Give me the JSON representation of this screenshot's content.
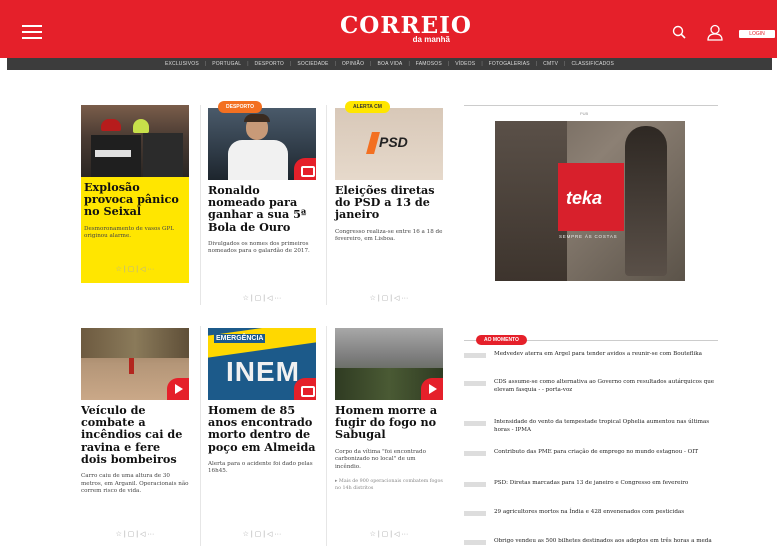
{
  "header": {
    "logo_main": "CORREIO",
    "logo_sub": "da manhã",
    "login_label": "LOGIN"
  },
  "nav": [
    "EXCLUSIVOS",
    "PORTUGAL",
    "DESPORTO",
    "SOCIEDADE",
    "OPINIÃO",
    "BOA VIDA",
    "FAMOSOS",
    "VÍDEOS",
    "FOTOGALERIAS",
    "CMTV",
    "CLASSIFICADOS"
  ],
  "cards": [
    {
      "title": "Explosão provoca pânico no Seixal",
      "lead": "Desmoronamento de vasos GPL originou alarme.",
      "tag": ""
    },
    {
      "title": "Ronaldo nomeado para ganhar a sua 5ª Bola de Ouro",
      "lead": "Divulgados os nomes dos primeiros nomeados para o galardão de 2017.",
      "tag": "DESPORTO"
    },
    {
      "title": "Eleições diretas do PSD a 13 de janeiro",
      "lead": "Congresso realiza-se entre 16 a 18 de fevereiro, em Lisboa.",
      "tag": "ALERTA CM",
      "image_text": "PSD"
    },
    {
      "title": "Veículo de combate a incêndios cai de ravina e fere dois bombeiros",
      "lead": "Carro caiu de uma altura de 30 metros, em Arganil. Operacionais não correm risco de vida."
    },
    {
      "title": "Homem de 85 anos encontrado morto dentro de poço em Almeida",
      "lead": "Alerta para o acidente foi dado pelas 16h45.",
      "image_text_top": "EMERGÊNCIA",
      "image_text": "INEM"
    },
    {
      "title": "Homem morre a fugir do fogo no Sabugal",
      "lead": "Corpo da vítima \"foi encontrado carbonizado no local\" de um incêndio.",
      "related": "▸ Mais de 900 operacionais combatem fogos no 14h distritos"
    }
  ],
  "actions": "☆ | ▢ | ◁ ···",
  "ad": {
    "label": "PUB",
    "brand": "teka",
    "slogan": "SEMPRE ÁS COSTAS"
  },
  "latest": {
    "label": "AO MOMENTO",
    "items": [
      "Medvedev aterra em Argel para tender avidos a reunir-se com Bouteflika",
      "CDS assume-se como alternativa ao Governo com resultados autárquicos que elevam fasquia - - porta-voz",
      "Intensidade do vento da tempestade tropical Ophelia aumentou nas últimas horas - IPMA",
      "Contributo das PME para criação de emprego no mundo estagnou - OIT",
      "PSD: Diretas marcadas para 13 de janeiro e Congresso em fevereiro",
      "29 agricultores mortos na Índia e 428 envenenados com pesticidas",
      "Obrigo vendeu as 500 bilhetes destinados aos adeptos em três horas a meda"
    ]
  },
  "colors": {
    "brand_red": "#e5202a",
    "nav_dark": "#3c3c3c",
    "highlight_yellow": "#ffe600",
    "tag_orange": "#f37021"
  }
}
